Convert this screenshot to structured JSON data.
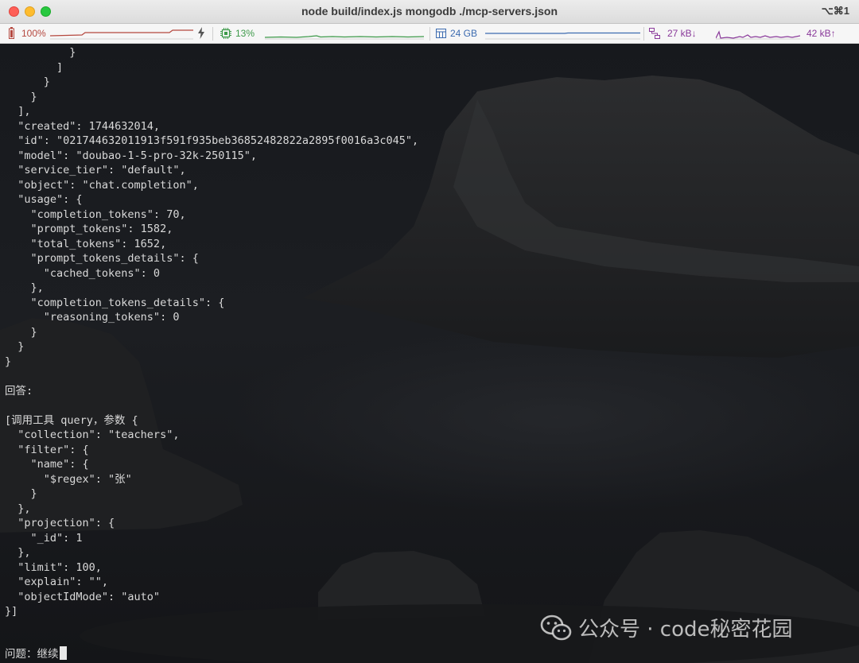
{
  "window": {
    "title": "node build/index.js mongodb ./mcp-servers.json",
    "shortcut": "⌥⌘1"
  },
  "statusbar": {
    "battery": {
      "icon": "battery-icon",
      "value": "100%"
    },
    "charging_icon": "lightning-icon",
    "cpu": {
      "icon": "cpu-icon",
      "value": "13%"
    },
    "memory": {
      "icon": "memory-icon",
      "value": "24 GB"
    },
    "network": {
      "icon": "network-icon",
      "down": "27 kB↓",
      "up": "42 kB↑"
    }
  },
  "terminal": {
    "output_lines": [
      "          }",
      "        ]",
      "      }",
      "    }",
      "  ],",
      "  \"created\": 1744632014,",
      "  \"id\": \"021744632011913f591f935beb36852482822a2895f0016a3c045\",",
      "  \"model\": \"doubao-1-5-pro-32k-250115\",",
      "  \"service_tier\": \"default\",",
      "  \"object\": \"chat.completion\",",
      "  \"usage\": {",
      "    \"completion_tokens\": 70,",
      "    \"prompt_tokens\": 1582,",
      "    \"total_tokens\": 1652,",
      "    \"prompt_tokens_details\": {",
      "      \"cached_tokens\": 0",
      "    },",
      "    \"completion_tokens_details\": {",
      "      \"reasoning_tokens\": 0",
      "    }",
      "  }",
      "}",
      "",
      "回答:",
      "",
      "[调用工具 query，参数 {",
      "  \"collection\": \"teachers\",",
      "  \"filter\": {",
      "    \"name\": {",
      "      \"$regex\": \"张\"",
      "    }",
      "  },",
      "  \"projection\": {",
      "    \"_id\": 1",
      "  },",
      "  \"limit\": 100,",
      "  \"explain\": \"\",",
      "  \"objectIdMode\": \"auto\"",
      "}]"
    ],
    "prompt": "问题：继续"
  },
  "watermark": {
    "icon": "wechat-icon",
    "text": "公众号 · code秘密花园"
  },
  "colors": {
    "terminal_text": "#d9d9d9",
    "terminal_bg": "#16181c",
    "cpu_accent": "#3e9a4a",
    "memory_accent": "#3c6bb0",
    "network_accent": "#8a3a9a",
    "battery_accent": "#b5483f"
  }
}
